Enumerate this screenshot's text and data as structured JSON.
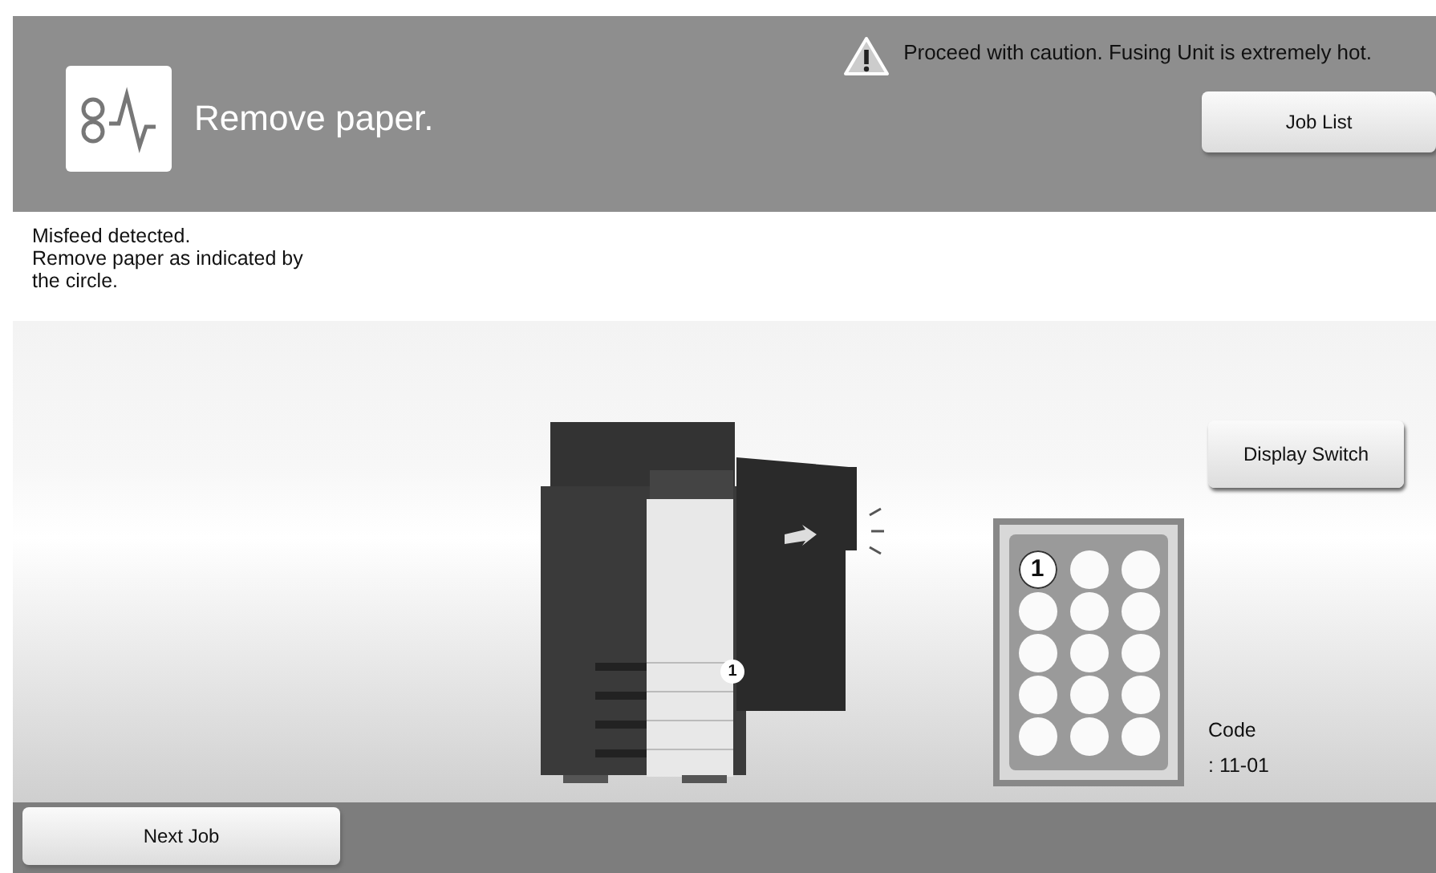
{
  "header": {
    "title": "Remove paper.",
    "warning": "Proceed with caution. Fusing Unit is extremely hot.",
    "job_list_button": "Job List"
  },
  "message": [
    "Misfeed detected.",
    "Remove paper as indicated by",
    "the circle."
  ],
  "machine": {
    "marker": "1"
  },
  "location_grid": {
    "slots": [
      {
        "label": "1",
        "selected": true
      },
      {
        "selected": false
      },
      {
        "selected": false
      },
      {
        "selected": false
      },
      {
        "selected": false
      },
      {
        "selected": false
      },
      {
        "selected": false
      },
      {
        "selected": false
      },
      {
        "selected": false
      },
      {
        "selected": false
      },
      {
        "selected": false
      },
      {
        "selected": false
      },
      {
        "selected": false
      },
      {
        "selected": false
      },
      {
        "selected": false
      }
    ]
  },
  "display_switch_button": "Display Switch",
  "code": {
    "label": "Code",
    "value": ": 11-01"
  },
  "bottom": {
    "next_job_button": "Next Job"
  }
}
